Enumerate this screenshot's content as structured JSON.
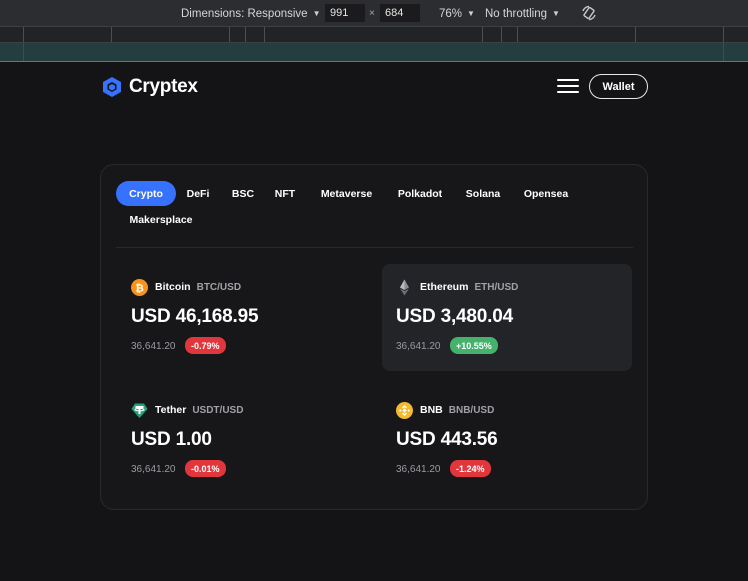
{
  "devtools": {
    "dimensions_label": "Dimensions: Responsive",
    "width_value": "991",
    "times": "×",
    "height_value": "684",
    "zoom": "76%",
    "throttling": "No throttling"
  },
  "header": {
    "brand": "Cryptex",
    "wallet_label": "Wallet"
  },
  "tabs": [
    {
      "label": "Crypto",
      "active": true
    },
    {
      "label": "DeFi"
    },
    {
      "label": "BSC"
    },
    {
      "label": "NFT"
    },
    {
      "label": "Metaverse"
    },
    {
      "label": "Polkadot"
    },
    {
      "label": "Solana"
    },
    {
      "label": "Opensea"
    },
    {
      "label": "Makersplace"
    }
  ],
  "assets": [
    {
      "name": "Bitcoin",
      "pair": "BTC/USD",
      "price": "USD 46,168.95",
      "volume": "36,641.20",
      "change": "-0.79%",
      "direction": "down",
      "icon": "bitcoin-icon"
    },
    {
      "name": "Ethereum",
      "pair": "ETH/USD",
      "price": "USD 3,480.04",
      "volume": "36,641.20",
      "change": "+10.55%",
      "direction": "up",
      "icon": "ethereum-icon"
    },
    {
      "name": "Tether",
      "pair": "USDT/USD",
      "price": "USD 1.00",
      "volume": "36,641.20",
      "change": "-0.01%",
      "direction": "down",
      "icon": "tether-icon"
    },
    {
      "name": "BNB",
      "pair": "BNB/USD",
      "price": "USD 443.56",
      "volume": "36,641.20",
      "change": "-1.24%",
      "direction": "down",
      "icon": "bnb-icon"
    }
  ],
  "colors": {
    "accent": "#3772ff",
    "down": "#e2363d",
    "up": "#45b26b",
    "background": "#141416"
  }
}
